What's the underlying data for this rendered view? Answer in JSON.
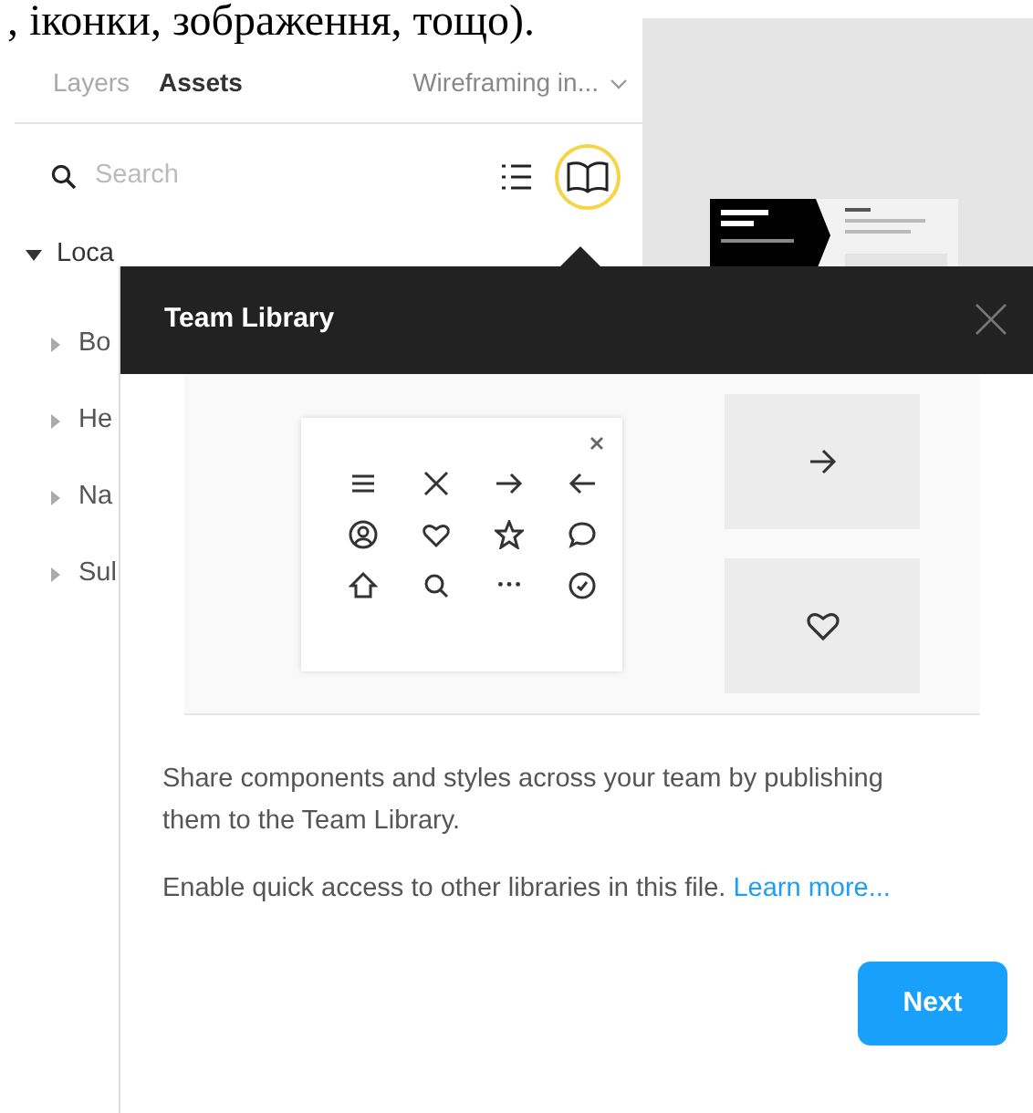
{
  "caption": ", іконки, зображення, тощо).",
  "panel": {
    "tabs": [
      {
        "label": "Layers",
        "selected": false
      },
      {
        "label": "Assets",
        "selected": true
      }
    ],
    "file_menu": "Wireframing in...",
    "search": {
      "placeholder": "Search"
    },
    "library_button": {
      "highlighted": true
    },
    "sections": [
      {
        "label": "Loca",
        "expanded": true,
        "children": [
          {
            "label": "Bo",
            "expanded": false
          },
          {
            "label": "He",
            "expanded": false
          },
          {
            "label": "Na",
            "expanded": false
          },
          {
            "label": "Sul",
            "expanded": false
          }
        ]
      }
    ]
  },
  "popup": {
    "title": "Team Library",
    "paragraphs": [
      "Share components and styles across your team by publishing them to the Team Library.",
      "Enable quick access to other libraries in this file."
    ],
    "link": "Learn more...",
    "button": "Next"
  }
}
